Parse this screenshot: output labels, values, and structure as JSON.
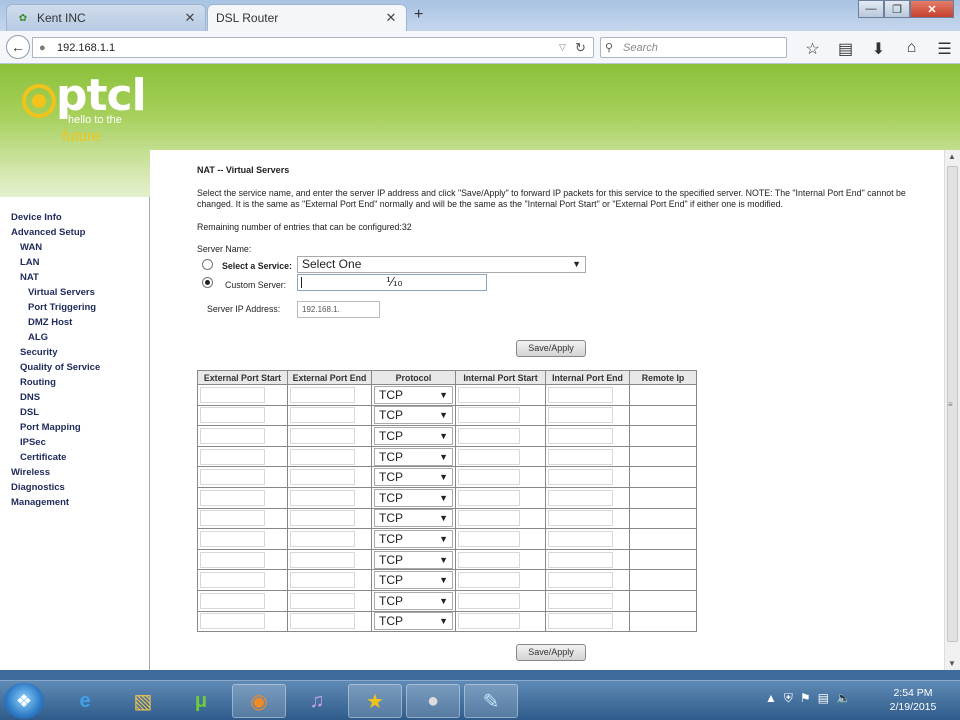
{
  "browser": {
    "tabs": [
      {
        "title": "Kent INC",
        "favicon": "leaf-icon"
      },
      {
        "title": "DSL Router",
        "favicon": "blank-page-icon"
      }
    ],
    "new_tab": "+",
    "url": "192.168.1.1",
    "search_placeholder": "Search"
  },
  "logo": {
    "brand": "ptcl",
    "tagline_line1": "hello to the",
    "tagline_line2": "future"
  },
  "sidebar": {
    "items": [
      {
        "label": "Device Info",
        "level": 0
      },
      {
        "label": "Advanced Setup",
        "level": 0
      },
      {
        "label": "WAN",
        "level": 1
      },
      {
        "label": "LAN",
        "level": 1
      },
      {
        "label": "NAT",
        "level": 1
      },
      {
        "label": "Virtual Servers",
        "level": 2
      },
      {
        "label": "Port Triggering",
        "level": 2
      },
      {
        "label": "DMZ Host",
        "level": 2
      },
      {
        "label": "ALG",
        "level": 2
      },
      {
        "label": "Security",
        "level": 1
      },
      {
        "label": "Quality of Service",
        "level": 1
      },
      {
        "label": "Routing",
        "level": 1
      },
      {
        "label": "DNS",
        "level": 1
      },
      {
        "label": "DSL",
        "level": 1
      },
      {
        "label": "Port Mapping",
        "level": 1
      },
      {
        "label": "IPSec",
        "level": 1
      },
      {
        "label": "Certificate",
        "level": 1
      },
      {
        "label": "Wireless",
        "level": 0
      },
      {
        "label": "Diagnostics",
        "level": 0
      },
      {
        "label": "Management",
        "level": 0
      }
    ]
  },
  "content": {
    "title": "NAT -- Virtual Servers",
    "description": "Select the service name, and enter the server IP address and click \"Save/Apply\" to forward IP packets for this service to the specified server. NOTE: The \"Internal Port End\" cannot be changed. It is the same as \"External Port End\" normally and will be the same as the \"Internal Port Start\" or \"External Port End\" if either one is modified.",
    "remaining": "Remaining number of entries that can be configured:32",
    "server_name_label": "Server Name:",
    "select_service_label": "Select a Service:",
    "select_service_value": "Select One",
    "custom_server_label": "Custom Server:",
    "custom_server_value": "",
    "server_ip_label": "Server IP Address:",
    "server_ip_value": "192.168.1.",
    "save_apply": "Save/Apply"
  },
  "table": {
    "headers": [
      "External Port Start",
      "External Port End",
      "Protocol",
      "Internal Port Start",
      "Internal Port End",
      "Remote Ip"
    ],
    "protocol_value": "TCP",
    "row_count": 12
  },
  "taskbar": {
    "time": "2:54 PM",
    "date": "2/19/2015"
  }
}
